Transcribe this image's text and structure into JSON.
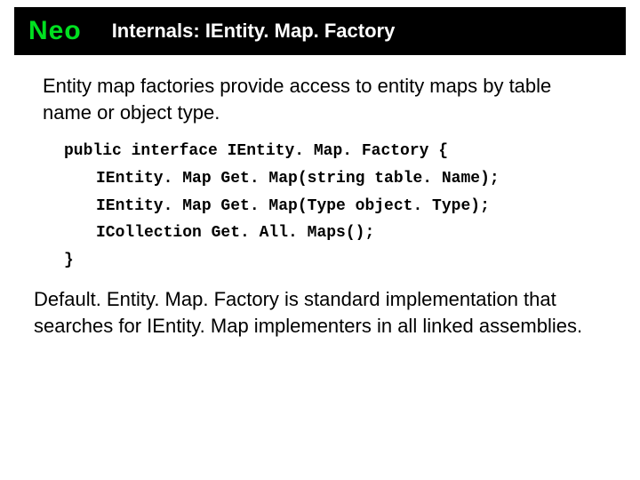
{
  "header": {
    "logo": "Neo",
    "title": "Internals: IEntity. Map. Factory"
  },
  "body": {
    "intro": "Entity map factories provide access to entity maps by table name or object type.",
    "code": [
      "public interface IEntity. Map. Factory {",
      "IEntity. Map Get. Map(string table. Name);",
      "IEntity. Map Get. Map(Type object. Type);",
      "ICollection Get. All. Maps();",
      "}"
    ],
    "closing": "Default. Entity. Map. Factory is standard implementation that searches for IEntity. Map implementers in all linked assemblies."
  }
}
